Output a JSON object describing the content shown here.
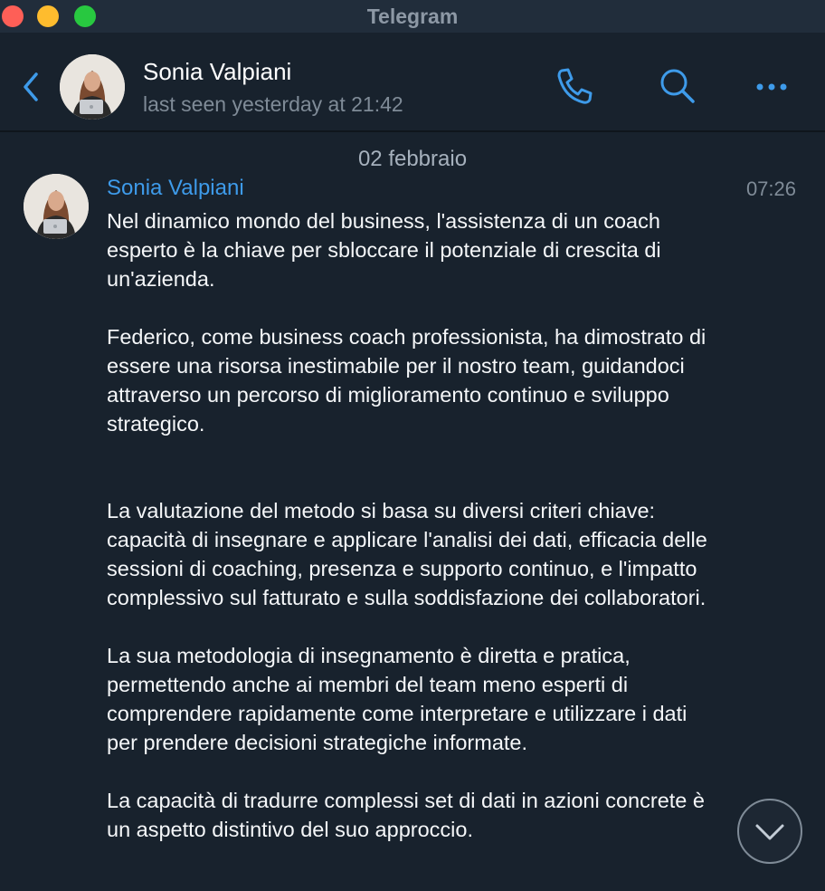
{
  "window": {
    "title": "Telegram"
  },
  "header": {
    "contact_name": "Sonia Valpiani",
    "status": "last seen yesterday at 21:42"
  },
  "chat": {
    "date_separator": "02 febbraio",
    "message": {
      "sender": "Sonia Valpiani",
      "time": "07:26",
      "paragraphs": [
        "Nel dinamico mondo del business, l'assistenza di un coach esperto è la chiave per sbloccare il potenziale di crescita di un'azienda.",
        "Federico, come business coach professionista, ha dimostrato di essere una risorsa inestimabile per il nostro team, guidandoci attraverso un percorso di miglioramento continuo e sviluppo strategico.",
        "La valutazione del metodo si basa su diversi criteri chiave: capacità di insegnare e applicare l'analisi dei dati, efficacia delle sessioni di coaching, presenza e supporto continuo, e l'impatto complessivo sul fatturato e sulla soddisfazione dei collaboratori.",
        "La sua metodologia di insegnamento è diretta e pratica, permettendo anche ai membri del team meno esperti di comprendere rapidamente come interpretare e utilizzare i dati per prendere decisioni strategiche informate.",
        "La capacità di tradurre complessi set di dati in azioni concrete è un aspetto distintivo del suo approccio."
      ]
    }
  },
  "colors": {
    "background": "#18222d",
    "titlebar": "#212d3b",
    "accent": "#3e9bea",
    "text_primary": "#f5f7f9",
    "text_secondary": "#7f8b97"
  },
  "icons": {
    "back": "chevron-left-icon",
    "phone": "phone-icon",
    "search": "search-icon",
    "more": "more-dots-icon",
    "scroll": "chevron-down-icon"
  }
}
